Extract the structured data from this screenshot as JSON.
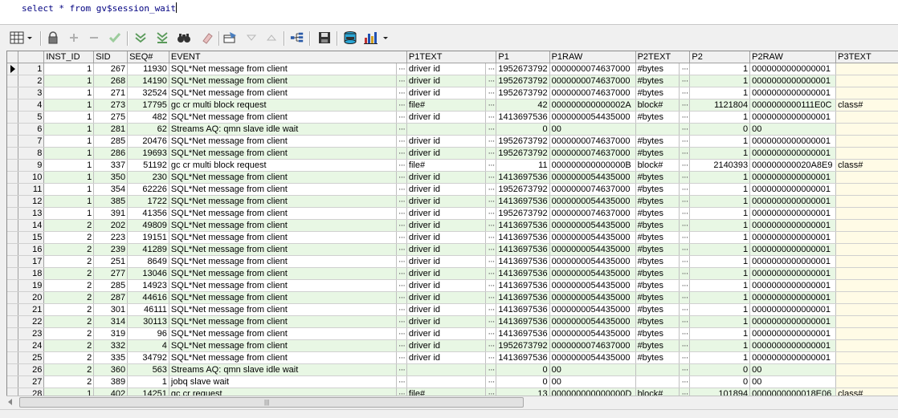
{
  "sql_editor": {
    "text": "select * from gv$session_wait"
  },
  "toolbar": {
    "icons": [
      "grid-menu-icon",
      "lock-icon",
      "add-record-icon",
      "delete-record-icon",
      "post-edit-icon",
      "fetch-next-icon",
      "fetch-all-icon",
      "find-icon",
      "clear-icon",
      "query-by-example-icon",
      "sort-asc-icon",
      "sort-desc-icon",
      "tree-icon",
      "save-icon",
      "export-icon",
      "chart-icon"
    ]
  },
  "grid": {
    "columns": [
      "INST_ID",
      "SID",
      "SEQ#",
      "EVENT",
      "P1TEXT",
      "P1",
      "P1RAW",
      "P2TEXT",
      "P2",
      "P2RAW",
      "P3TEXT"
    ],
    "rows": [
      [
        "1",
        "1",
        "267",
        "11930",
        "SQL*Net message from client",
        "driver id",
        "1952673792",
        "0000000074637000",
        "#bytes",
        "1",
        "0000000000000001",
        ""
      ],
      [
        "2",
        "1",
        "268",
        "14190",
        "SQL*Net message from client",
        "driver id",
        "1952673792",
        "0000000074637000",
        "#bytes",
        "1",
        "0000000000000001",
        ""
      ],
      [
        "3",
        "1",
        "271",
        "32524",
        "SQL*Net message from client",
        "driver id",
        "1952673792",
        "0000000074637000",
        "#bytes",
        "1",
        "0000000000000001",
        ""
      ],
      [
        "4",
        "1",
        "273",
        "17795",
        "gc cr multi block request",
        "file#",
        "42",
        "000000000000002A",
        "block#",
        "1121804",
        "0000000000111E0C",
        "class#"
      ],
      [
        "5",
        "1",
        "275",
        "482",
        "SQL*Net message from client",
        "driver id",
        "1413697536",
        "0000000054435000",
        "#bytes",
        "1",
        "0000000000000001",
        ""
      ],
      [
        "6",
        "1",
        "281",
        "62",
        "Streams AQ: qmn slave idle wait",
        "",
        "0",
        "00",
        "",
        "0",
        "00",
        ""
      ],
      [
        "7",
        "1",
        "285",
        "20476",
        "SQL*Net message from client",
        "driver id",
        "1952673792",
        "0000000074637000",
        "#bytes",
        "1",
        "0000000000000001",
        ""
      ],
      [
        "8",
        "1",
        "286",
        "19693",
        "SQL*Net message from client",
        "driver id",
        "1952673792",
        "0000000074637000",
        "#bytes",
        "1",
        "0000000000000001",
        ""
      ],
      [
        "9",
        "1",
        "337",
        "51192",
        "gc cr multi block request",
        "file#",
        "11",
        "000000000000000B",
        "block#",
        "2140393",
        "000000000020A8E9",
        "class#"
      ],
      [
        "10",
        "1",
        "350",
        "230",
        "SQL*Net message from client",
        "driver id",
        "1413697536",
        "0000000054435000",
        "#bytes",
        "1",
        "0000000000000001",
        ""
      ],
      [
        "11",
        "1",
        "354",
        "62226",
        "SQL*Net message from client",
        "driver id",
        "1952673792",
        "0000000074637000",
        "#bytes",
        "1",
        "0000000000000001",
        ""
      ],
      [
        "12",
        "1",
        "385",
        "1722",
        "SQL*Net message from client",
        "driver id",
        "1413697536",
        "0000000054435000",
        "#bytes",
        "1",
        "0000000000000001",
        ""
      ],
      [
        "13",
        "1",
        "391",
        "41356",
        "SQL*Net message from client",
        "driver id",
        "1952673792",
        "0000000074637000",
        "#bytes",
        "1",
        "0000000000000001",
        ""
      ],
      [
        "14",
        "2",
        "202",
        "49809",
        "SQL*Net message from client",
        "driver id",
        "1413697536",
        "0000000054435000",
        "#bytes",
        "1",
        "0000000000000001",
        ""
      ],
      [
        "15",
        "2",
        "223",
        "19151",
        "SQL*Net message from client",
        "driver id",
        "1413697536",
        "0000000054435000",
        "#bytes",
        "1",
        "0000000000000001",
        ""
      ],
      [
        "16",
        "2",
        "239",
        "41289",
        "SQL*Net message from client",
        "driver id",
        "1413697536",
        "0000000054435000",
        "#bytes",
        "1",
        "0000000000000001",
        ""
      ],
      [
        "17",
        "2",
        "251",
        "8649",
        "SQL*Net message from client",
        "driver id",
        "1413697536",
        "0000000054435000",
        "#bytes",
        "1",
        "0000000000000001",
        ""
      ],
      [
        "18",
        "2",
        "277",
        "13046",
        "SQL*Net message from client",
        "driver id",
        "1413697536",
        "0000000054435000",
        "#bytes",
        "1",
        "0000000000000001",
        ""
      ],
      [
        "19",
        "2",
        "285",
        "14923",
        "SQL*Net message from client",
        "driver id",
        "1413697536",
        "0000000054435000",
        "#bytes",
        "1",
        "0000000000000001",
        ""
      ],
      [
        "20",
        "2",
        "287",
        "44616",
        "SQL*Net message from client",
        "driver id",
        "1413697536",
        "0000000054435000",
        "#bytes",
        "1",
        "0000000000000001",
        ""
      ],
      [
        "21",
        "2",
        "301",
        "46111",
        "SQL*Net message from client",
        "driver id",
        "1413697536",
        "0000000054435000",
        "#bytes",
        "1",
        "0000000000000001",
        ""
      ],
      [
        "22",
        "2",
        "314",
        "30113",
        "SQL*Net message from client",
        "driver id",
        "1413697536",
        "0000000054435000",
        "#bytes",
        "1",
        "0000000000000001",
        ""
      ],
      [
        "23",
        "2",
        "319",
        "96",
        "SQL*Net message from client",
        "driver id",
        "1413697536",
        "0000000054435000",
        "#bytes",
        "1",
        "0000000000000001",
        ""
      ],
      [
        "24",
        "2",
        "332",
        "4",
        "SQL*Net message from client",
        "driver id",
        "1952673792",
        "0000000074637000",
        "#bytes",
        "1",
        "0000000000000001",
        ""
      ],
      [
        "25",
        "2",
        "335",
        "34792",
        "SQL*Net message from client",
        "driver id",
        "1413697536",
        "0000000054435000",
        "#bytes",
        "1",
        "0000000000000001",
        ""
      ],
      [
        "26",
        "2",
        "360",
        "563",
        "Streams AQ: qmn slave idle wait",
        "",
        "0",
        "00",
        "",
        "0",
        "00",
        ""
      ],
      [
        "27",
        "2",
        "389",
        "1",
        "jobq slave wait",
        "",
        "0",
        "00",
        "",
        "0",
        "00",
        ""
      ],
      [
        "28",
        "1",
        "402",
        "14251",
        "gc cr request",
        "file#",
        "13",
        "000000000000000D",
        "block#",
        "101894",
        "0000000000018E06",
        "class#"
      ]
    ]
  },
  "scrollbar": {
    "grip": "|||"
  }
}
